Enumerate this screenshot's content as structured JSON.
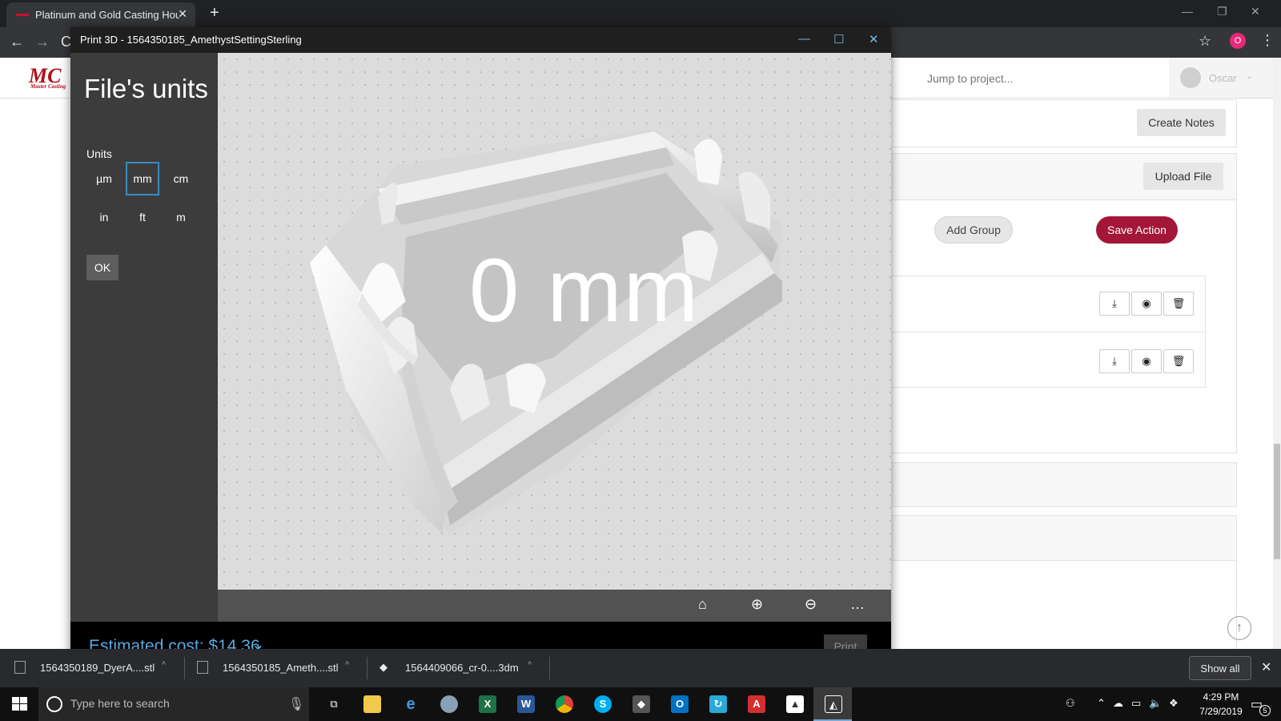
{
  "browser": {
    "tab_title": "Platinum and Gold Casting House",
    "new_tab_symbol": "+",
    "tab_close_symbol": "✕"
  },
  "page": {
    "logo_text": "MC",
    "logo_subtext": "Master Casting",
    "jump_placeholder": "Jump to project...",
    "user_name": "Oscar",
    "create_notes_label": "Create Notes",
    "upload_file_label": "Upload File",
    "add_group_label": "Add Group",
    "save_action_label": "Save Action",
    "colors": {
      "save_action": "#a31637",
      "logo": "#b01018"
    }
  },
  "print3d": {
    "window_title": "Print 3D - 1564350185_AmethystSettingSterling",
    "heading": "File's units",
    "units_label": "Units",
    "units": [
      "µm",
      "mm",
      "cm",
      "in",
      "ft",
      "m"
    ],
    "selected_unit": "mm",
    "ok_label": "OK",
    "dimension_overlay": "0 mm",
    "estimated_cost": "Estimated cost: $14.36",
    "print_label": "Print",
    "more_symbol": "…",
    "accent_color": "#3a8bc4"
  },
  "downloads": {
    "items": [
      "1564350189_DyerA....stl",
      "1564350185_Ameth....stl",
      "1564409066_cr-0....3dm"
    ],
    "show_all_label": "Show all"
  },
  "taskbar": {
    "search_placeholder": "Type here to search",
    "time": "4:29 PM",
    "date": "7/29/2019",
    "notification_count": "5",
    "apps": [
      "file-explorer",
      "edge",
      "cinema4d",
      "excel",
      "word",
      "chrome",
      "skype",
      "rhino",
      "outlook",
      "onedrive",
      "acrobat",
      "photos",
      "print3d"
    ]
  }
}
